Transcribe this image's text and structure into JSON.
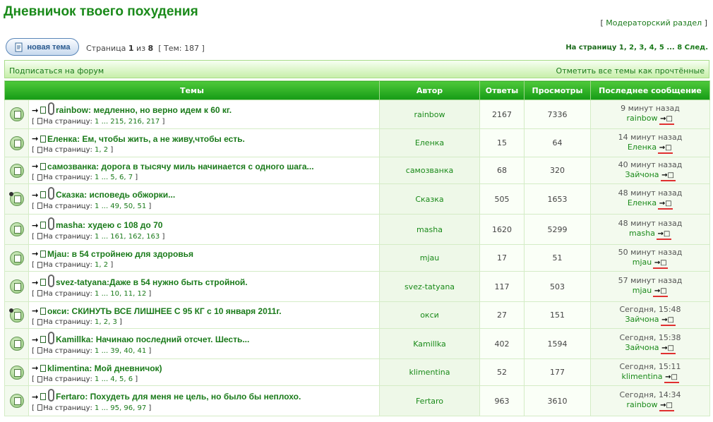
{
  "forum_title": "Дневничок твоего похудения",
  "moderator_link": "Модераторский раздел",
  "new_topic_label": "новая тема",
  "page_label": "Страница",
  "page_current": "1",
  "page_of": "из",
  "page_total": "8",
  "topics_count_text": "[ Тем: 187 ]",
  "pagenav": {
    "label": "На страницу",
    "pages": [
      "1",
      "2",
      "3",
      "4",
      "5"
    ],
    "ellipsis": "...",
    "last": "8",
    "next": "След."
  },
  "subscribe_link": "Подписаться на форум",
  "mark_read_link": "Отметить все темы как прочтённые",
  "headers": {
    "topics": "Темы",
    "author": "Автор",
    "replies": "Ответы",
    "views": "Просмотры",
    "last_post": "Последнее сообщение"
  },
  "topic_pages_label": "На страницу:",
  "topics": [
    {
      "title": "rainbow: медленно, но верно идем к 60 кг.",
      "pages": "1 ... 215, 216, 217",
      "author": "rainbow",
      "replies": "2167",
      "views": "7336",
      "last_time": "9 минут назад",
      "last_by": "rainbow",
      "hot": false,
      "clip": true
    },
    {
      "title": "Еленка: Ем, чтобы жить, а не живу,чтобы есть.",
      "pages": "1, 2",
      "author": "Еленка",
      "replies": "15",
      "views": "64",
      "last_time": "14 минут назад",
      "last_by": "Еленка",
      "hot": false,
      "clip": false
    },
    {
      "title": "самозванка: дорога в тысячу миль начинается с одного шага...",
      "pages": "1 ... 5, 6, 7",
      "author": "самозванка",
      "replies": "68",
      "views": "320",
      "last_time": "40 минут назад",
      "last_by": "Зайчона",
      "hot": false,
      "clip": false
    },
    {
      "title": "Сказка: исповедь обжорки...",
      "pages": "1 ... 49, 50, 51",
      "author": "Сказка",
      "replies": "505",
      "views": "1653",
      "last_time": "48 минут назад",
      "last_by": "Еленка",
      "hot": true,
      "clip": true
    },
    {
      "title": "masha: худею с 108 до 70",
      "pages": "1 ... 161, 162, 163",
      "author": "masha",
      "replies": "1620",
      "views": "5299",
      "last_time": "48 минут назад",
      "last_by": "masha",
      "hot": false,
      "clip": true
    },
    {
      "title": "Mjau: в 54 стройнею для здоровья",
      "pages": "1, 2",
      "author": "mjau",
      "replies": "17",
      "views": "51",
      "last_time": "50 минут назад",
      "last_by": "mjau",
      "hot": false,
      "clip": false
    },
    {
      "title": "svez-tatyana:Даже в 54 нужно быть стройной.",
      "pages": "1 ... 10, 11, 12",
      "author": "svez-tatyana",
      "replies": "117",
      "views": "503",
      "last_time": "57 минут назад",
      "last_by": "mjau",
      "hot": false,
      "clip": true
    },
    {
      "title": "окси: СКИНУТЬ ВСЕ ЛИШНЕЕ С 95 КГ с 10 января 2011г.",
      "pages": "1, 2, 3",
      "author": "окси",
      "replies": "27",
      "views": "151",
      "last_time": "Сегодня, 15:48",
      "last_by": "Зайчона",
      "hot": true,
      "clip": false
    },
    {
      "title": "Kamillka: Начинаю последний отсчет. Шесть...",
      "pages": "1 ... 39, 40, 41",
      "author": "Kamillka",
      "replies": "402",
      "views": "1594",
      "last_time": "Сегодня, 15:38",
      "last_by": "Зайчона",
      "hot": false,
      "clip": true
    },
    {
      "title": "klimentina: Мой дневничок)",
      "pages": "1 ... 4, 5, 6",
      "author": "klimentina",
      "replies": "52",
      "views": "177",
      "last_time": "Сегодня, 15:11",
      "last_by": "klimentina",
      "hot": false,
      "clip": false
    },
    {
      "title": "Fertaro: Похудеть для меня не цель, но было бы неплохо.",
      "pages": "1 ... 95, 96, 97",
      "author": "Fertaro",
      "replies": "963",
      "views": "3610",
      "last_time": "Сегодня, 14:34",
      "last_by": "rainbow",
      "hot": false,
      "clip": true
    }
  ]
}
